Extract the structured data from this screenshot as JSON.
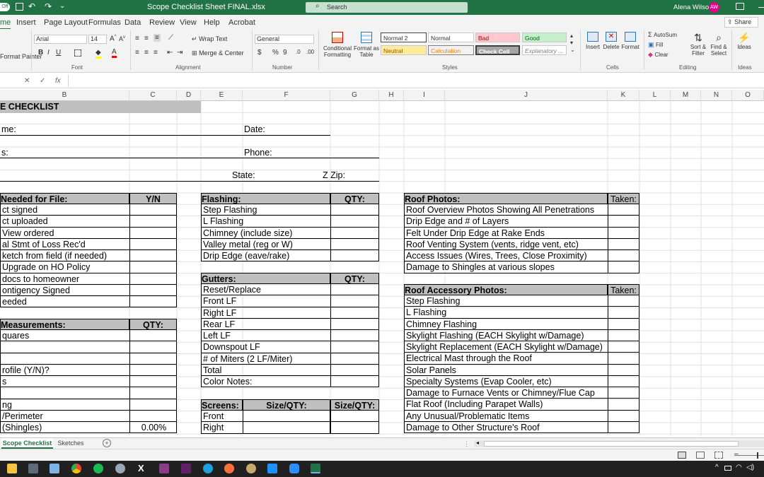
{
  "titlebar": {
    "autosave": "Off",
    "filename": "Scope Checklist Sheet FINAL.xlsx",
    "search_placeholder": "Search",
    "user_name": "Alena Wilson",
    "user_initials": "AW"
  },
  "ribbon_tabs": [
    "me",
    "Insert",
    "Page Layout",
    "Formulas",
    "Data",
    "Review",
    "View",
    "Help",
    "Acrobat"
  ],
  "share_label": "Share",
  "ribbon": {
    "clipboard_partial": "Format Painter",
    "font_name": "Arial",
    "font_size": "14",
    "wrap_text": "Wrap Text",
    "merge_center": "Merge & Center",
    "number_format": "General",
    "conditional_formatting": "Conditional Formatting",
    "format_as_table": "Format as Table",
    "styles": {
      "normal2": "Normal 2",
      "normal": "Normal",
      "bad": "Bad",
      "good": "Good",
      "neutral": "Neutral",
      "calculation": "Calculation",
      "check_cell": "Check Cell",
      "explanatory": "Explanatory ..."
    },
    "insert": "Insert",
    "delete": "Delete",
    "format": "Format",
    "autosum": "AutoSum",
    "fill": "Fill",
    "clear": "Clear",
    "sort_filter": "Sort & Filter",
    "find_select": "Find & Select",
    "ideas": "Ideas",
    "group_labels": {
      "font": "Font",
      "alignment": "Alignment",
      "number": "Number",
      "styles": "Styles",
      "cells": "Cells",
      "editing": "Editing",
      "ideas": "Ideas"
    }
  },
  "formula_bar": {
    "fx": "fx",
    "value": ""
  },
  "columns": [
    "B",
    "C",
    "D",
    "E",
    "F",
    "G",
    "H",
    "I",
    "J",
    "K",
    "L",
    "M",
    "N",
    "O"
  ],
  "sheet": {
    "title": "E CHECKLIST",
    "name_label": "me:",
    "date_label": "Date:",
    "address_label": "s:",
    "phone_label": "Phone:",
    "state_label": "State:",
    "zip_label": "Z Zip:",
    "file_section": {
      "header": "Needed for File:",
      "col": "Y/N",
      "items": [
        "ct signed",
        "ct uploaded",
        "View ordered",
        "al Stmt of Loss Rec'd",
        "ketch from field (if needed)",
        "Upgrade on HO Policy",
        "docs to homeowner",
        "ontigency Signed",
        "eeded"
      ]
    },
    "measurements": {
      "header": "Measurements:",
      "col": "QTY:",
      "items": [
        "quares",
        "",
        "",
        "rofile (Y/N)?",
        "s",
        "",
        "ng",
        "/Perimeter",
        " (Shingles)"
      ],
      "pct_value": "0.00%"
    },
    "flashing": {
      "header": "Flashing:",
      "col": "QTY:",
      "items": [
        "Step Flashing",
        "L Flashing",
        "Chimney (include size)",
        "Valley metal (reg or W)",
        "Drip Edge (eave/rake)"
      ]
    },
    "gutters": {
      "header": "Gutters:",
      "col": "QTY:",
      "items": [
        "Reset/Replace",
        "Front LF",
        "Right LF",
        "Rear LF",
        "Left LF",
        "Downspout LF",
        "# of Miters (2 LF/Miter)",
        "Total",
        "Color Notes:"
      ]
    },
    "screens": {
      "header": "Screens:",
      "col1": "Size/QTY:",
      "col2": "Size/QTY:",
      "items": [
        "Front",
        "Right"
      ]
    },
    "roof_photos": {
      "header": "Roof Photos:",
      "col": "Taken:",
      "items": [
        "Roof Overview Photos Showing All Penetrations",
        "Drip Edge and # of Layers",
        "Felt Under Drip Edge at Rake Ends",
        "Roof Venting System (vents, ridge vent, etc)",
        "Access Issues (Wires, Trees, Close Proximity)",
        "Damage to Shingles at various slopes"
      ]
    },
    "accessory_photos": {
      "header": "Roof Accessory Photos:",
      "col": "Taken:",
      "items": [
        "Step Flashing",
        "L Flashing",
        "Chimney Flashing",
        "Skylight Flashing (EACH Skylight w/Damage)",
        "Skylight Replacement (EACH Skylight w/Damage)",
        "Electrical Mast through the Roof",
        "Solar Panels",
        "Specialty Systems (Evap Cooler, etc)",
        "Damage to Furnace Vents or Chimney/Flue Cap",
        "Flat Roof (Including Parapet Walls)",
        "Any Unusual/Problematic Items",
        "Damage to Other Structure's Roof"
      ]
    }
  },
  "sheet_tabs": [
    "Scope Checklist",
    "Sketches"
  ],
  "active_tab": "Scope Checklist",
  "colors": {
    "excel_green": "#217346",
    "header_gray": "#bfbfbf"
  }
}
